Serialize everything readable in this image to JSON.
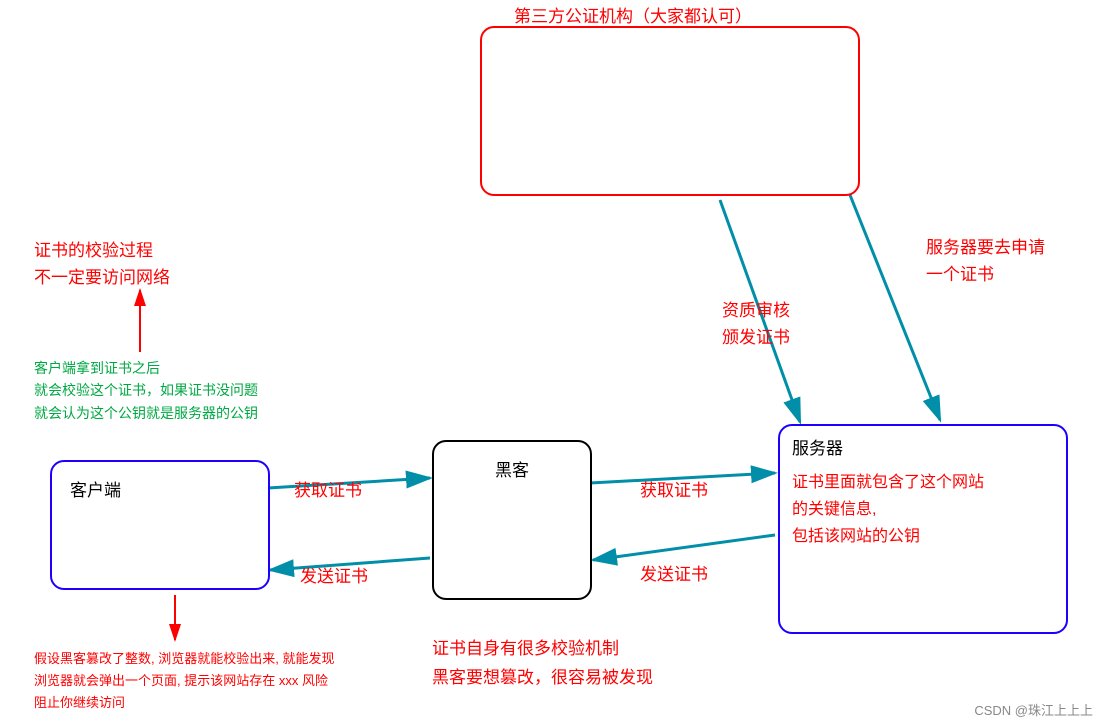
{
  "title_ca": "第三方公证机构（大家都认可）",
  "box_client": "客户端",
  "box_hacker": "黑客",
  "box_server": "服务器",
  "server_inner1": "证书里面就包含了这个网站",
  "server_inner2": "的关键信息,",
  "server_inner3": "包括该网站的公钥",
  "note_verify1": "证书的校验过程",
  "note_verify2": "不一定要访问网络",
  "note_client_green1": "客户端拿到证书之后",
  "note_client_green2": "就会校验这个证书，如果证书没问题",
  "note_client_green3": "就会认为这个公钥就是服务器的公钥",
  "arrow_get_cert": "获取证书",
  "arrow_send_cert": "发送证书",
  "arrow_audit1": "资质审核",
  "arrow_audit2": "颁发证书",
  "arrow_apply1": "服务器要去申请",
  "arrow_apply2": "一个证书",
  "note_hacker1": "证书自身有很多校验机制",
  "note_hacker2": "黑客要想篡改，很容易被发现",
  "note_bottom1": "假设黑客篡改了整数, 浏览器就能校验出来, 就能发现",
  "note_bottom2": "浏览器就会弹出一个页面, 提示该网站存在 xxx 风险",
  "note_bottom3": "阻止你继续访问",
  "watermark": "CSDN @珠江上上上",
  "colors": {
    "red": "#ff0000",
    "blue": "#1e00ff",
    "teal": "#008ea8",
    "green": "#00a843"
  },
  "chart_data": {
    "type": "diagram",
    "nodes": [
      {
        "id": "ca",
        "label": "第三方公证机构（大家都认可）"
      },
      {
        "id": "client",
        "label": "客户端"
      },
      {
        "id": "hacker",
        "label": "黑客"
      },
      {
        "id": "server",
        "label": "服务器"
      }
    ],
    "edges": [
      {
        "from": "server",
        "to": "ca",
        "label": "服务器要去申请一个证书"
      },
      {
        "from": "ca",
        "to": "server",
        "label": "资质审核 颁发证书"
      },
      {
        "from": "client",
        "to": "hacker",
        "label": "获取证书"
      },
      {
        "from": "hacker",
        "to": "server",
        "label": "获取证书"
      },
      {
        "from": "server",
        "to": "hacker",
        "label": "发送证书"
      },
      {
        "from": "hacker",
        "to": "client",
        "label": "发送证书"
      }
    ],
    "annotations": [
      "证书的校验过程 不一定要访问网络",
      "客户端拿到证书之后 就会校验这个证书，如果证书没问题 就会认为这个公钥就是服务器的公钥",
      "证书里面就包含了这个网站的关键信息, 包括该网站的公钥",
      "证书自身有很多校验机制 黑客要想篡改，很容易被发现",
      "假设黑客篡改了整数, 浏览器就能校验出来, 就能发现 浏览器就会弹出一个页面, 提示该网站存在 xxx 风险 阻止你继续访问"
    ]
  }
}
